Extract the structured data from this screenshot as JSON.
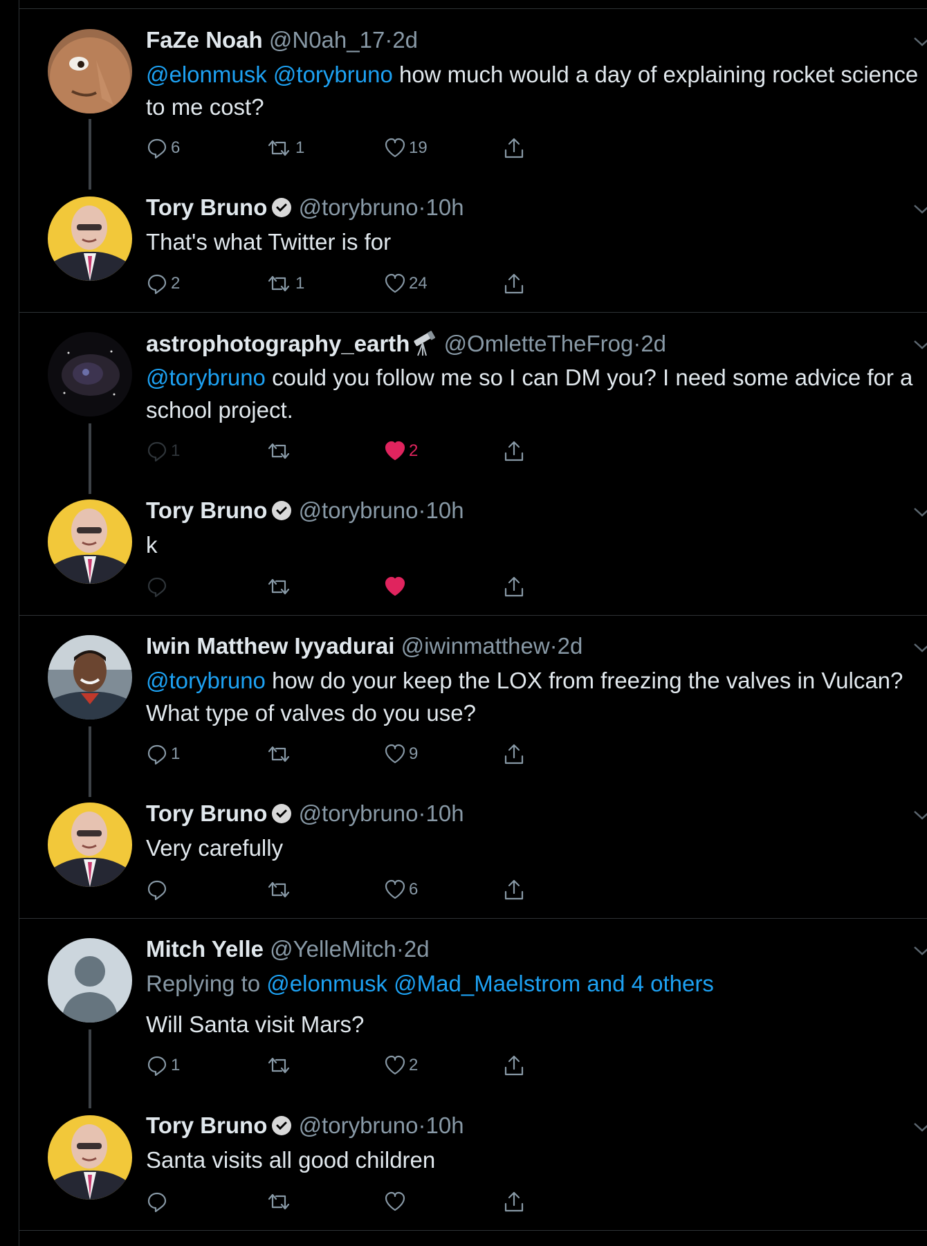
{
  "tweets": [
    {
      "name": "FaZe Noah",
      "handle": "@N0ah_17",
      "time": "2d",
      "mentions": "@elonmusk @torybruno",
      "text": " how much would a day of explaining rocket science to me cost?",
      "replies": "6",
      "retweets": "1",
      "likes": "19",
      "avatar_icon": "cartoon-face-avatar"
    },
    {
      "name": "Tory Bruno",
      "handle": "@torybruno",
      "time": "10h",
      "text": "That's what Twitter is for",
      "replies": "2",
      "retweets": "1",
      "likes": "24",
      "avatar_icon": "man-in-suit-avatar"
    },
    {
      "name": "astrophotography_earth",
      "emoji": "telescope-icon",
      "handle": "@OmletteTheFrog",
      "time": "2d",
      "mentions": "@torybruno",
      "text": " could you follow me so I can DM you? I need some advice for a school project.",
      "replies": "1",
      "retweets": "",
      "likes": "2",
      "liked": true,
      "avatar_icon": "nebula-avatar"
    },
    {
      "name": "Tory Bruno",
      "handle": "@torybruno",
      "time": "10h",
      "text": "k",
      "replies": "",
      "retweets": "",
      "likes": "",
      "liked": true,
      "avatar_icon": "man-in-suit-avatar"
    },
    {
      "name": "Iwin Matthew Iyyadurai",
      "handle": "@iwinmatthew",
      "time": "2d",
      "mentions": "@torybruno",
      "text": " how do your keep the LOX from freezing the valves in Vulcan? What type of valves do you use?",
      "replies": "1",
      "retweets": "",
      "likes": "9",
      "avatar_icon": "smiling-man-avatar"
    },
    {
      "name": "Tory Bruno",
      "handle": "@torybruno",
      "time": "10h",
      "text": "Very carefully",
      "replies": "",
      "retweets": "",
      "likes": "6",
      "avatar_icon": "man-in-suit-avatar"
    },
    {
      "name": "Mitch Yelle",
      "handle": "@YelleMitch",
      "time": "2d",
      "replying_prefix": "Replying to ",
      "replying_to": "@elonmusk @Mad_Maelstrom and 4 others",
      "text": "Will Santa visit Mars?",
      "replies": "1",
      "retweets": "",
      "likes": "2",
      "avatar_icon": "default-profile-avatar"
    },
    {
      "name": "Tory Bruno",
      "handle": "@torybruno",
      "time": "10h",
      "text": "Santa visits all good children",
      "replies": "",
      "retweets": "",
      "likes": "",
      "avatar_icon": "man-in-suit-avatar"
    }
  ],
  "separator": "·",
  "colors": {
    "background": "#000000",
    "text": "#e1e8ed",
    "muted": "#8899a6",
    "link": "#1da1f2",
    "like": "#e0245e",
    "divider": "#2f3336"
  }
}
